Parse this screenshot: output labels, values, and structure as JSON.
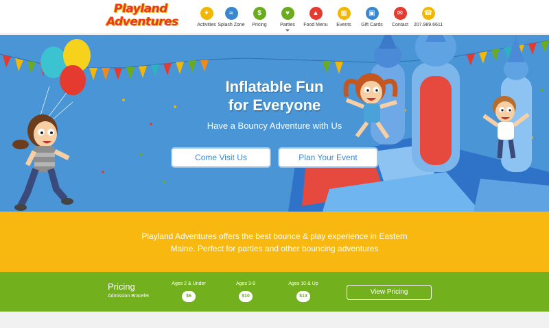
{
  "logo": {
    "line1": "Playland",
    "line2": "Adventures"
  },
  "nav": {
    "items": [
      {
        "label": "Activities",
        "icon": "activities-icon",
        "glyph": "✦",
        "color": "#f2b705"
      },
      {
        "label": "Splash Zone",
        "icon": "splash-zone-icon",
        "glyph": "≈",
        "color": "#3a86cf"
      },
      {
        "label": "Pricing",
        "icon": "pricing-icon",
        "glyph": "$",
        "color": "#6aac1e"
      },
      {
        "label": "Parties",
        "icon": "parties-icon",
        "glyph": "♥",
        "color": "#6aac1e"
      },
      {
        "label": "Food Menu",
        "icon": "food-menu-icon",
        "glyph": "▲",
        "color": "#e43a2f"
      },
      {
        "label": "Events",
        "icon": "events-icon",
        "glyph": "▦",
        "color": "#f2b705"
      },
      {
        "label": "Gift Cards",
        "icon": "gift-cards-icon",
        "glyph": "▣",
        "color": "#3a86cf"
      },
      {
        "label": "Contact",
        "icon": "contact-icon",
        "glyph": "✉",
        "color": "#e43a2f"
      },
      {
        "label": "207.989.6611",
        "icon": "phone-icon",
        "glyph": "☎",
        "color": "#f2b705"
      }
    ]
  },
  "hero": {
    "title_line1": "Inflatable Fun",
    "title_line2": "for Everyone",
    "subtitle": "Have a Bouncy Adventure with Us",
    "btn_visit": "Come Visit Us",
    "btn_plan": "Plan Your Event"
  },
  "band": {
    "text": "Playland Adventures offers the best bounce & play experience in Eastern Maine. Perfect for parties and other bouncing adventures"
  },
  "pricing": {
    "title": "Pricing",
    "subtitle": "Admission Bracelet",
    "tiers": [
      {
        "label": "Ages 2 & Under",
        "price": "$6"
      },
      {
        "label": "Ages 3-9",
        "price": "$10"
      },
      {
        "label": "Ages 10 & Up",
        "price": "$13"
      }
    ],
    "button": "View Pricing"
  },
  "colors": {
    "hero_bg": "#4a95d6",
    "band_bg": "#f9b80f",
    "pricing_bg": "#72b11d",
    "accent_blue": "#3a86cf",
    "logo_red": "#e9372b"
  }
}
